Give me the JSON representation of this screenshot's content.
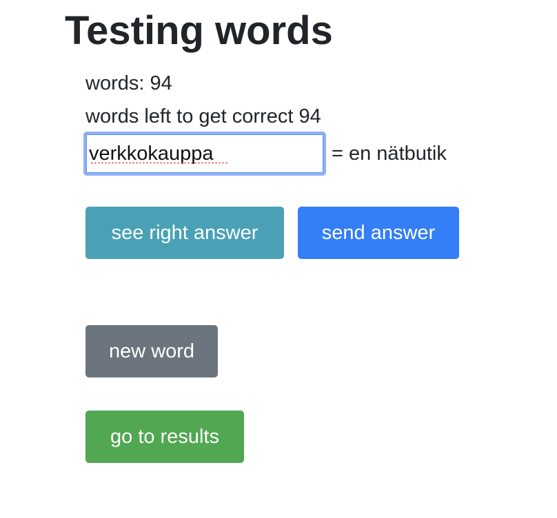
{
  "page": {
    "title": "Testing words"
  },
  "stats": {
    "words_text": "words: 94",
    "words_left_text": "words left to get correct 94"
  },
  "answer": {
    "input_value": "verkkokauppa",
    "translation_text": "= en nätbutik"
  },
  "buttons": {
    "see_right_answer": "see right answer",
    "send_answer": "send answer",
    "new_word": "new word",
    "go_to_results": "go to results"
  },
  "colors": {
    "info": "#4aa1b6",
    "primary": "#347ef7",
    "secondary": "#6c757d",
    "success": "#51a752",
    "focus_border": "#8fb1f4"
  }
}
